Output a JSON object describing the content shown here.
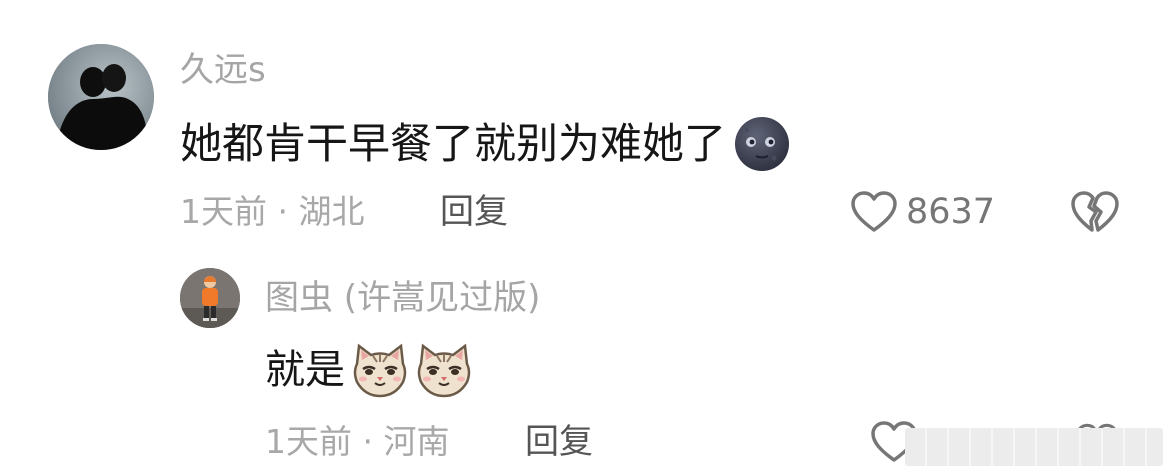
{
  "comment": {
    "avatar": "avatar-silhouette",
    "username": "久远s",
    "content": "她都肯干早餐了就别为难她了",
    "emoji": "new-moon-face-emoji",
    "time": "1天前",
    "location": "湖北",
    "meta": "1天前 · 湖北",
    "reply_label": "回复",
    "like_count": "8637",
    "like_icon": "heart-outline-icon",
    "dislike_icon": "broken-heart-icon"
  },
  "reply": {
    "avatar": "avatar-child-orange-jacket",
    "username": "图虫 (许嵩见过版)",
    "content": "就是",
    "emojis": [
      "cat-face-emoji",
      "cat-face-emoji"
    ],
    "time": "1天前",
    "location": "河南",
    "meta": "1天前 · 河南",
    "reply_label": "回复",
    "like_icon": "heart-outline-icon",
    "dislike_icon": "broken-heart-icon"
  },
  "colors": {
    "text_primary": "#161616",
    "text_secondary": "#a5a5a5",
    "reply_text": "#555555",
    "icon": "#767676"
  }
}
